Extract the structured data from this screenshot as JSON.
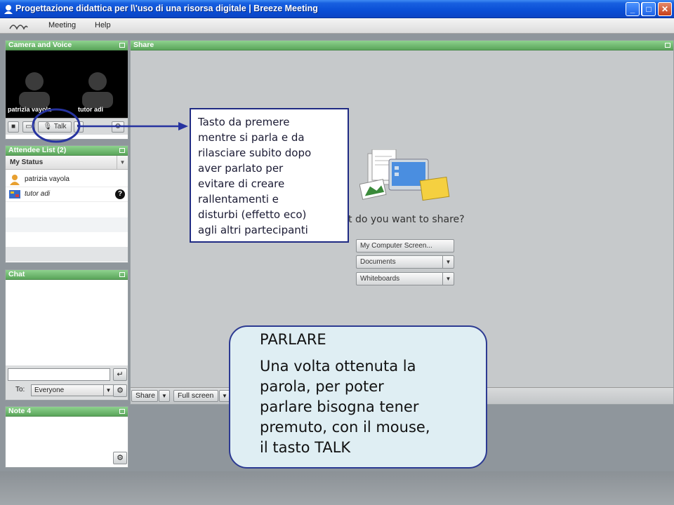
{
  "window": {
    "title": "Progettazione didattica per l\\'uso di una risorsa digitale | Breeze Meeting",
    "controls": {
      "minimize": "_",
      "maximize": "□",
      "close": "✕"
    }
  },
  "menubar": {
    "items": [
      "Meeting",
      "Help"
    ]
  },
  "camera_pod": {
    "title": "Camera and Voice",
    "participants": [
      "patrizia vayola",
      "tutor adi"
    ],
    "talk_label": "Talk"
  },
  "attendee_pod": {
    "title": "Attendee List (2)",
    "status_header": "My Status",
    "attendees": [
      {
        "name": "patrizia vayola",
        "icon": "host-icon"
      },
      {
        "name": "tutor adi",
        "icon": "participant-icon",
        "badge": "?"
      }
    ]
  },
  "chat_pod": {
    "title": "Chat",
    "to_label": "To:",
    "recipient": "Everyone",
    "input_value": ""
  },
  "note_pod": {
    "title": "Note 4"
  },
  "share_pod": {
    "title": "Share",
    "question": "t do you want to share?",
    "options": [
      "My Computer Screen...",
      "Documents",
      "Whiteboards"
    ],
    "bottom_buttons": [
      "Share",
      "Full screen"
    ]
  },
  "callout": {
    "text": "Tasto da premere\nmentre si parla e da\nrilasciare subito dopo\naver parlato per\nevitare di creare\nrallentamenti e\ndisturbi (effetto eco)\nagli altri partecipanti"
  },
  "bubble": {
    "title": "PARLARE",
    "body": "Una volta ottenuta la\nparola, per poter\nparlare bisogna tener\npremuto, con il mouse,\nil tasto TALK"
  },
  "colors": {
    "title_bar": "#0a4fd6",
    "pod_header": "#5aa55a",
    "annotation": "#1f2a83",
    "bubble_fill": "#dfeef3"
  }
}
